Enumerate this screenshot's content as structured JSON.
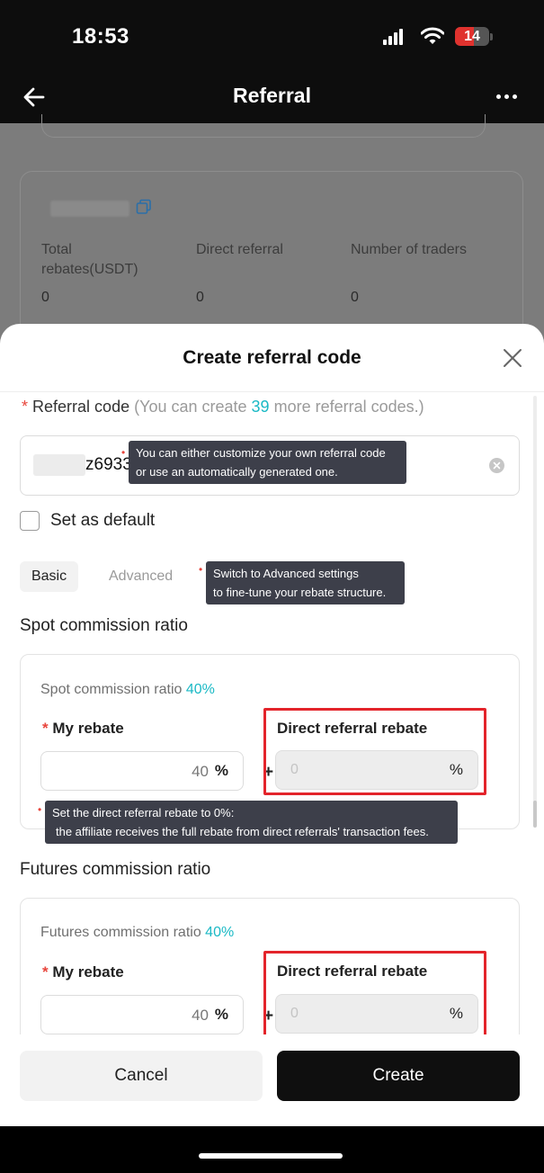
{
  "status_bar": {
    "time": "18:53",
    "battery": "14",
    "battery_level": 0.14
  },
  "nav": {
    "title": "Referral",
    "back_icon": "arrow-left-icon",
    "more_icon": "more-dots-icon"
  },
  "background_page": {
    "stats": [
      {
        "label": "Total rebates(USDT)",
        "value": "0"
      },
      {
        "label": "Direct referral",
        "value": "0"
      },
      {
        "label": "Number of traders",
        "value": "0"
      }
    ]
  },
  "sheet": {
    "title": "Create referral code",
    "referral_code": {
      "required_mark": "*",
      "label": "Referral code",
      "hint_prefix": "(You can create",
      "remaining": "39",
      "hint_suffix": "more referral codes.)",
      "value": "z6933"
    },
    "tooltips": {
      "code": [
        "You can either customize your own referral code",
        "or use an automatically generated one."
      ],
      "advanced": [
        "Switch to Advanced settings",
        "to fine-tune your rebate structure."
      ],
      "direct": [
        "Set the direct referral rebate to 0%:",
        "the affiliate receives the full rebate from direct referrals' transaction fees."
      ]
    },
    "set_default_label": "Set as default",
    "tabs": {
      "basic": "Basic",
      "advanced": "Advanced"
    },
    "spot": {
      "section_title": "Spot commission ratio",
      "caption": "Spot commission ratio",
      "ratio": "40%",
      "my_rebate_label": "My rebate",
      "my_rebate_value": "40",
      "percent": "%",
      "plus": "+",
      "direct_label": "Direct referral rebate",
      "direct_placeholder": "0"
    },
    "futures": {
      "section_title": "Futures commission ratio",
      "caption": "Futures commission ratio",
      "ratio": "40%",
      "my_rebate_label": "My rebate",
      "my_rebate_value": "40",
      "percent": "%",
      "plus": "+",
      "direct_label": "Direct referral rebate",
      "direct_placeholder": "0"
    },
    "buttons": {
      "cancel": "Cancel",
      "create": "Create"
    }
  },
  "colors": {
    "accent": "#1ab9c5",
    "required": "#e8453c",
    "highlight": "#e3242b",
    "primary_button": "#0f0f0f"
  }
}
